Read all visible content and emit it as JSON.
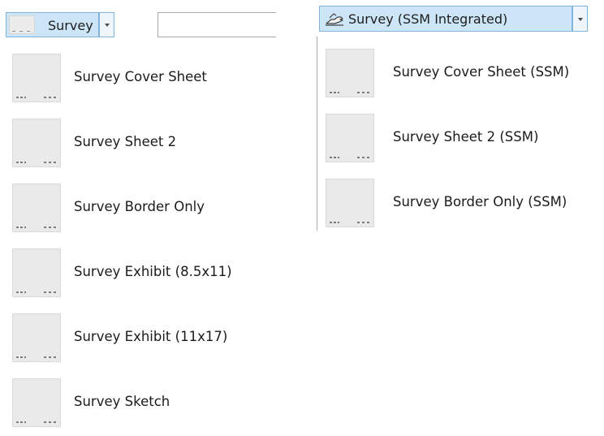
{
  "left": {
    "combo_label": "Survey",
    "search_value": "",
    "items": [
      {
        "label": "Survey Cover Sheet"
      },
      {
        "label": "Survey Sheet 2"
      },
      {
        "label": "Survey Border Only"
      },
      {
        "label": "Survey Exhibit (8.5x11)"
      },
      {
        "label": "Survey Exhibit (11x17)"
      },
      {
        "label": "Survey Sketch"
      }
    ]
  },
  "right": {
    "combo_label": "Survey (SSM Integrated)",
    "combo_icon": "surveyor-hand-icon",
    "items": [
      {
        "label": "Survey Cover Sheet (SSM)"
      },
      {
        "label": "Survey Sheet 2 (SSM)"
      },
      {
        "label": "Survey Border Only (SSM)"
      }
    ]
  },
  "colors": {
    "combo_selected_bg": "#cde6f7",
    "combo_border": "#7eb4dd",
    "thumb_bg": "#eaeaea"
  }
}
